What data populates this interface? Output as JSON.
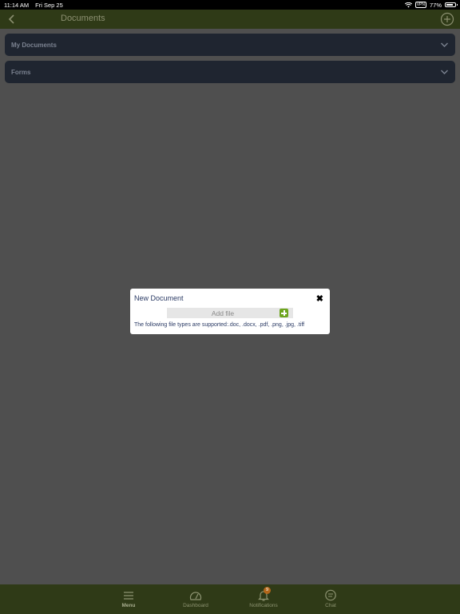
{
  "status_bar": {
    "time": "11:14 AM",
    "date": "Fri Sep 25",
    "vpn": "VPN",
    "battery": "77%"
  },
  "header": {
    "title": "Documents"
  },
  "accordions": [
    {
      "label": "My Documents"
    },
    {
      "label": "Forms"
    }
  ],
  "modal": {
    "title": "New Document",
    "close_glyph": "✖",
    "add_file_label": "Add file",
    "supported_text": "The following file types are supported:.doc, .docx, .pdf, .png, .jpg, .tiff"
  },
  "tabbar": {
    "tabs": [
      {
        "label": "Menu",
        "icon": "menu-icon"
      },
      {
        "label": "Dashboard",
        "icon": "dashboard-icon"
      },
      {
        "label": "Notifications",
        "icon": "bell-icon",
        "badge": "9"
      },
      {
        "label": "Chat",
        "icon": "chat-icon"
      }
    ]
  },
  "colors": {
    "header_bg": "#2f3a17",
    "accordion_bg": "#1f2530",
    "overlay_bg": "#4f4f4f",
    "accent_green": "#6ea51f",
    "badge": "#b2661a"
  }
}
